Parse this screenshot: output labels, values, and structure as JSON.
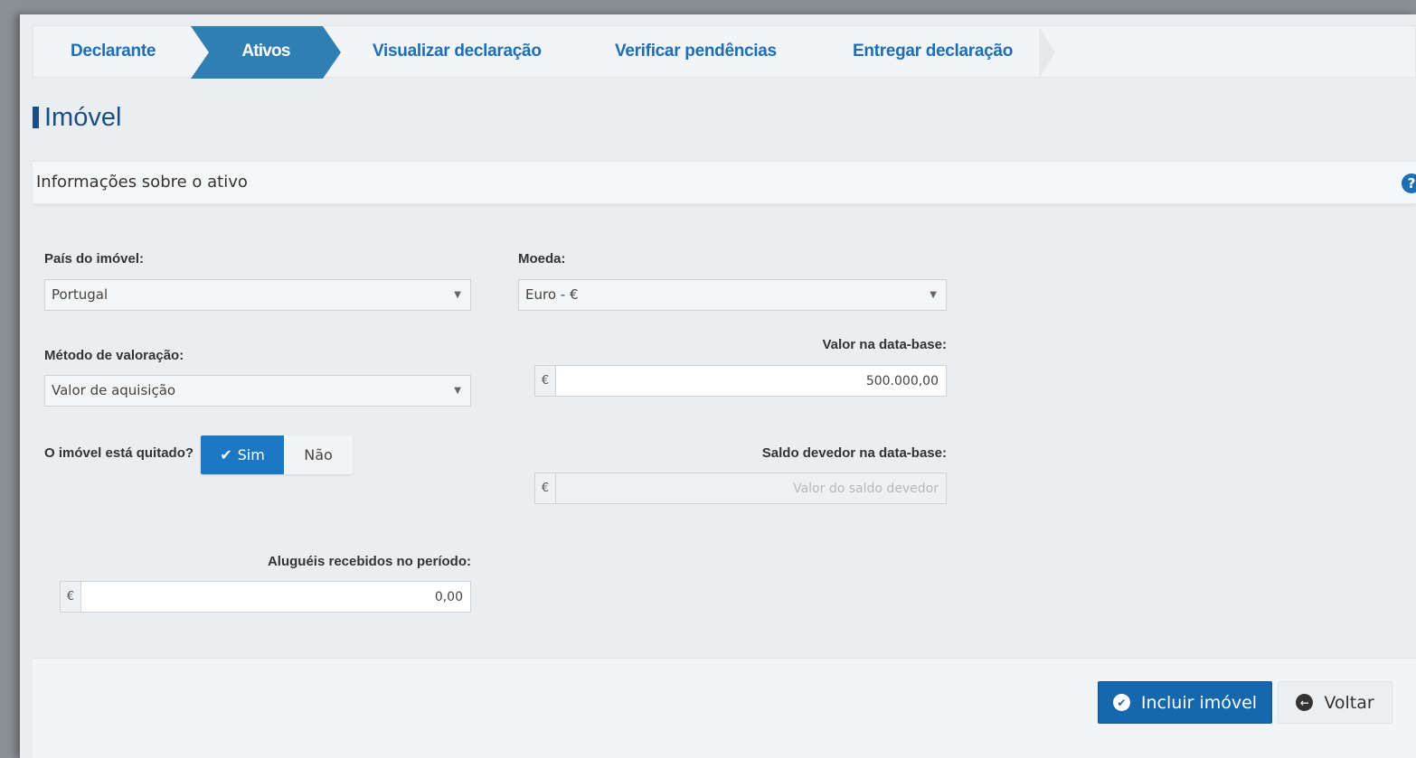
{
  "steps": [
    {
      "label": "Declarante",
      "active": false
    },
    {
      "label": "Ativos",
      "active": true
    },
    {
      "label": "Visualizar declaração",
      "active": false
    },
    {
      "label": "Verificar pendências",
      "active": false
    },
    {
      "label": "Entregar declaração",
      "active": false
    }
  ],
  "page": {
    "title": "Imóvel"
  },
  "section": {
    "title": "Informações sobre o ativo",
    "help_icon": "?"
  },
  "form": {
    "pais": {
      "label": "País do imóvel:",
      "value": "Portugal"
    },
    "moeda": {
      "label": "Moeda:",
      "value": "Euro - €"
    },
    "metodo": {
      "label": "Método de valoração:",
      "value": "Valor de aquisição"
    },
    "valor_data_base": {
      "label": "Valor na data-base:",
      "currency": "€",
      "value": "500.000,00"
    },
    "quitado": {
      "label": "O imóvel está quitado?",
      "yes": "Sim",
      "no": "Não",
      "selected": "Sim"
    },
    "saldo_devedor": {
      "label": "Saldo devedor na data-base:",
      "currency": "€",
      "placeholder": "Valor do saldo devedor"
    },
    "alugueis": {
      "label": "Aluguéis recebidos no período:",
      "currency": "€",
      "value": "0,00"
    }
  },
  "footer": {
    "include_label": "Incluir imóvel",
    "back_label": "Voltar"
  },
  "colors": {
    "primary": "#1668ae",
    "active_step": "#2f7fb5",
    "title": "#1a4f86",
    "link": "#1d6eb5"
  }
}
